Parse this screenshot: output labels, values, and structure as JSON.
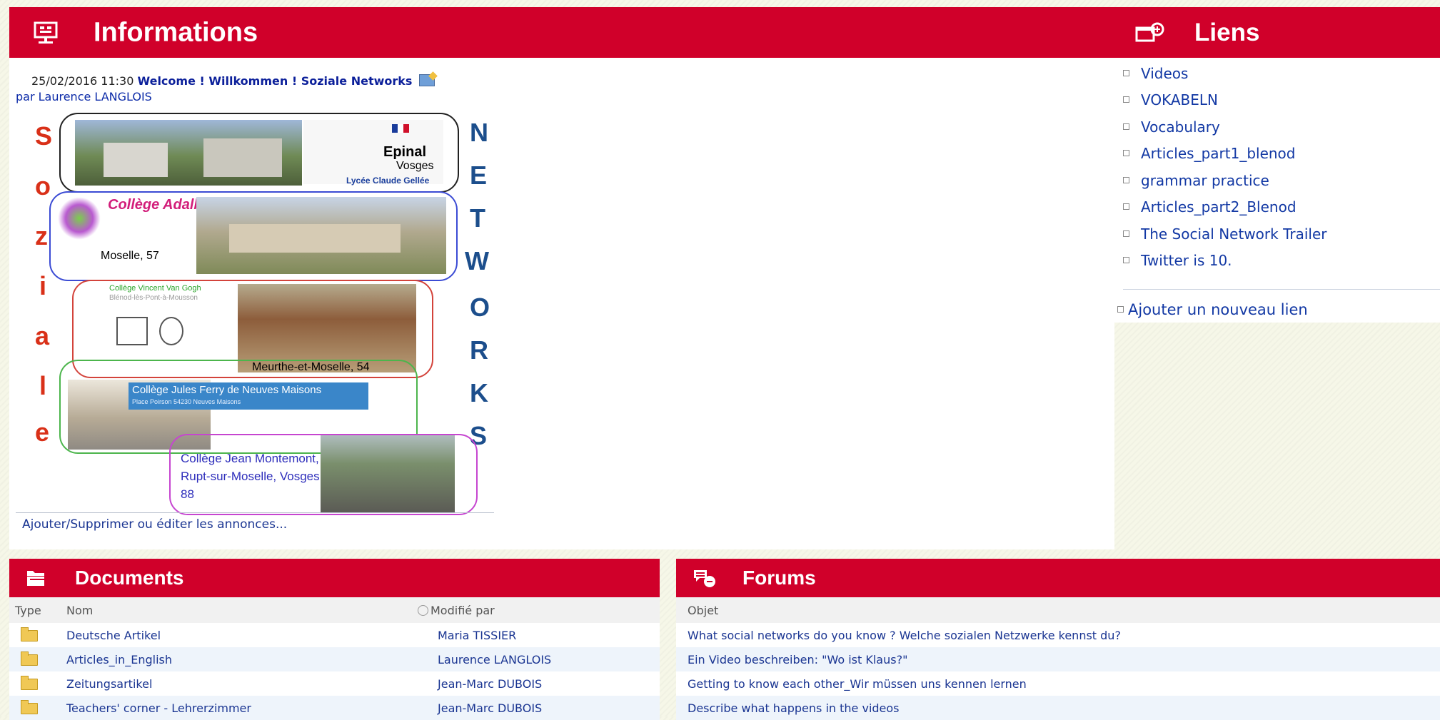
{
  "informations": {
    "title": "Informations",
    "icon": "presentation-icon",
    "post": {
      "datetime": "25/02/2016 11:30",
      "title": "Welcome ! Willkommen ! Soziale Networks",
      "author": "par Laurence LANGLOIS"
    },
    "image": {
      "left_letters": [
        "S",
        "o",
        "z",
        "i",
        "a",
        "l",
        "e"
      ],
      "right_letters": [
        "N",
        "E",
        "T",
        "W",
        "O",
        "R",
        "K",
        "S"
      ],
      "schools": [
        {
          "name": "Lycée Claude Gellée",
          "place": "Epinal",
          "region": "Vosges"
        },
        {
          "name": "Collège Adalbert",
          "place": "Moselle, 57"
        },
        {
          "name": "Collège Vincent Van Gogh",
          "place": "Blénod-lès-Pont-à-Mousson",
          "region": "Meurthe-et-Moselle, 54"
        },
        {
          "name": "Collège Jules Ferry de Neuves Maisons",
          "place": "Place Poirson 54230 Neuves Maisons"
        },
        {
          "name": "Collège Jean Montemont, Rupt-sur-Moselle, Vosges, 88"
        }
      ]
    },
    "manage_link": "Ajouter/Supprimer ou éditer les annonces..."
  },
  "liens": {
    "title": "Liens",
    "icon": "window-link-icon",
    "items": [
      "Videos",
      "VOKABELN",
      "Vocabulary",
      "Articles_part1_blenod",
      "grammar practice",
      "Articles_part2_Blenod",
      "The Social Network Trailer",
      "Twitter is 10."
    ],
    "add_label": "Ajouter un nouveau lien"
  },
  "documents": {
    "title": "Documents",
    "icon": "folders-icon",
    "columns": {
      "type": "Type",
      "name": "Nom",
      "modified": "Modifié par"
    },
    "rows": [
      {
        "name": "Deutsche Artikel",
        "modified_by": "Maria TISSIER"
      },
      {
        "name": "Articles_in_English",
        "modified_by": "Laurence LANGLOIS"
      },
      {
        "name": "Zeitungsartikel",
        "modified_by": "Jean-Marc DUBOIS"
      },
      {
        "name": "Teachers' corner - Lehrerzimmer",
        "modified_by": "Jean-Marc DUBOIS"
      }
    ]
  },
  "forums": {
    "title": "Forums",
    "icon": "chat-bubbles-icon",
    "column": "Objet",
    "rows": [
      "What social networks do you know ? Welche sozialen Netzwerke kennst du?",
      "Ein Video beschreiben: \"Wo ist Klaus?\"",
      "Getting to know each other_Wir müssen uns kennen lernen",
      "Describe what happens in the videos"
    ]
  },
  "colors": {
    "header": "#d0002a",
    "link": "#1a3592"
  }
}
